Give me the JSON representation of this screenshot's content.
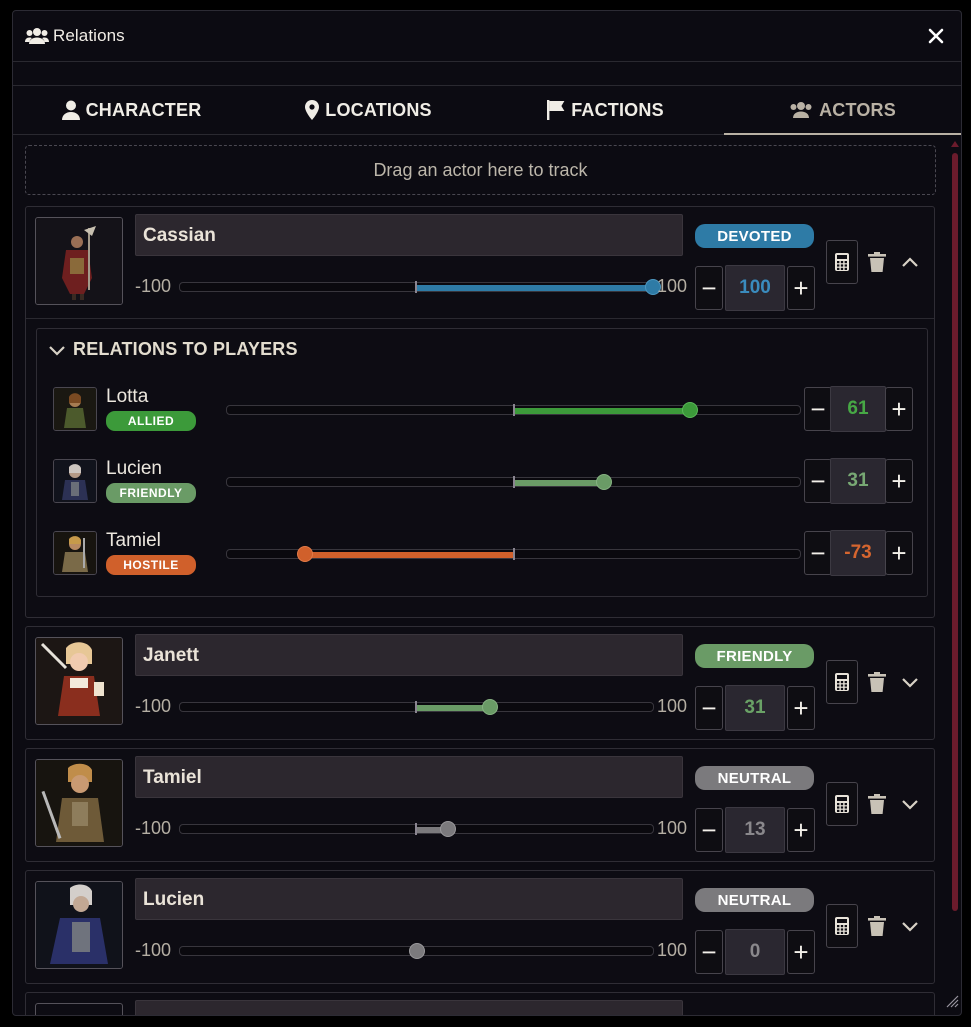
{
  "window": {
    "title": "Relations",
    "title_icon": "users-icon",
    "close_icon": "close-icon"
  },
  "tabs": [
    {
      "label": "CHARACTER",
      "icon": "user-icon",
      "active": false
    },
    {
      "label": "LOCATIONS",
      "icon": "map-pin-icon",
      "active": false
    },
    {
      "label": "FACTIONS",
      "icon": "flag-icon",
      "active": false
    },
    {
      "label": "ACTORS",
      "icon": "users-icon",
      "active": true
    }
  ],
  "dropzone": {
    "text": "Drag an actor here to track"
  },
  "range": {
    "min_label": "-100",
    "max_label": "100"
  },
  "colors": {
    "devoted": "#2e7ba6",
    "allied": "#3c9a3a",
    "friendly": "#6a9b66",
    "neutral": "#7b7a7d",
    "hostile": "#d0602b",
    "scrollbar": "#6b1b2c"
  },
  "actors": [
    {
      "name": "Cassian",
      "status": "DEVOTED",
      "value": "100",
      "expanded": true,
      "relations_title": "RELATIONS TO PLAYERS",
      "players": [
        {
          "name": "Lotta",
          "status": "ALLIED",
          "value": "61"
        },
        {
          "name": "Lucien",
          "status": "FRIENDLY",
          "value": "31"
        },
        {
          "name": "Tamiel",
          "status": "HOSTILE",
          "value": "-73"
        }
      ]
    },
    {
      "name": "Janett",
      "status": "FRIENDLY",
      "value": "31",
      "expanded": false
    },
    {
      "name": "Tamiel",
      "status": "NEUTRAL",
      "value": "13",
      "expanded": false
    },
    {
      "name": "Lucien",
      "status": "NEUTRAL",
      "value": "0",
      "expanded": false
    }
  ],
  "controls": {
    "minus": "−",
    "plus": "+"
  }
}
